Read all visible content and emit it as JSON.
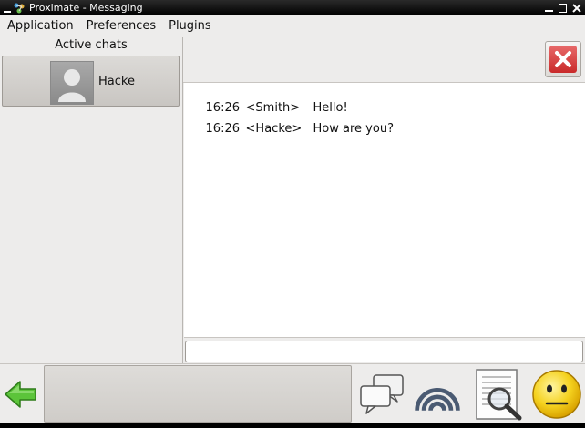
{
  "window": {
    "title": "Proximate - Messaging",
    "icons": [
      "minimize-icon",
      "app-icon",
      "min-button",
      "max-button",
      "close-button"
    ]
  },
  "menu": [
    "Application",
    "Preferences",
    "Plugins"
  ],
  "sidebar": {
    "header": "Active chats",
    "chats": [
      {
        "name": "Hacke",
        "icon": "user-avatar-icon"
      }
    ]
  },
  "conversation": {
    "close_icon": "close-x-icon",
    "messages": [
      {
        "time": "16:26",
        "sender": "<Smith>",
        "text": "Hello!"
      },
      {
        "time": "16:26",
        "sender": "<Hacke>",
        "text": "How are you?"
      }
    ],
    "input_value": ""
  },
  "toolbar": {
    "status_text": "",
    "icons": [
      "back-arrow-icon",
      "chat-bubbles-icon",
      "broadcast-signal-icon",
      "search-document-icon",
      "smiley-status-icon"
    ]
  },
  "colors": {
    "accent_green": "#5cc43a",
    "close_red": "#d23b3b",
    "smiley_yellow": "#f5d21f"
  }
}
